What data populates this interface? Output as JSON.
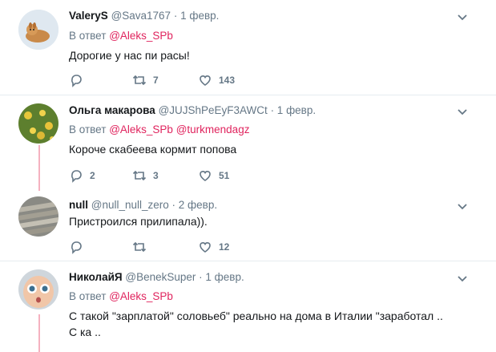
{
  "reply_prefix": "В ответ",
  "tweets": [
    {
      "name": "ValeryS",
      "handle": "@Sava1767",
      "date": "· 1 февр.",
      "mentions": [
        "@Aleks_SPb"
      ],
      "text": "Дорогие у нас пи    расы!",
      "replies": "",
      "retweets": "7",
      "likes": "143"
    },
    {
      "name": "Ольга макарова",
      "handle": "@JUJShPeEyF3AWCt",
      "date": "· 1 февр.",
      "mentions": [
        "@Aleks_SPb",
        "@turkmendagz"
      ],
      "text": "Короче скабеева кормит попова",
      "replies": "2",
      "retweets": "3",
      "likes": "51"
    },
    {
      "name": "null",
      "handle": "@null_null_zero",
      "date": "· 2 февр.",
      "mentions": [],
      "text": "Пристроился прилипала)).",
      "replies": "",
      "retweets": "",
      "likes": "12"
    },
    {
      "name": "НиколайЯ",
      "handle": "@BenekSuper",
      "date": "· 1 февр.",
      "mentions": [
        "@Aleks_SPb"
      ],
      "text": "С такой \"зарплатой\" соловьеб\" реально на дома в Италии \"заработал ..",
      "text2": "С  ка ..",
      "replies": "",
      "retweets": "",
      "likes": ""
    }
  ],
  "colors": {
    "mention": "#e0245e",
    "thread": "#f5b1c0",
    "icon": "#657786"
  }
}
